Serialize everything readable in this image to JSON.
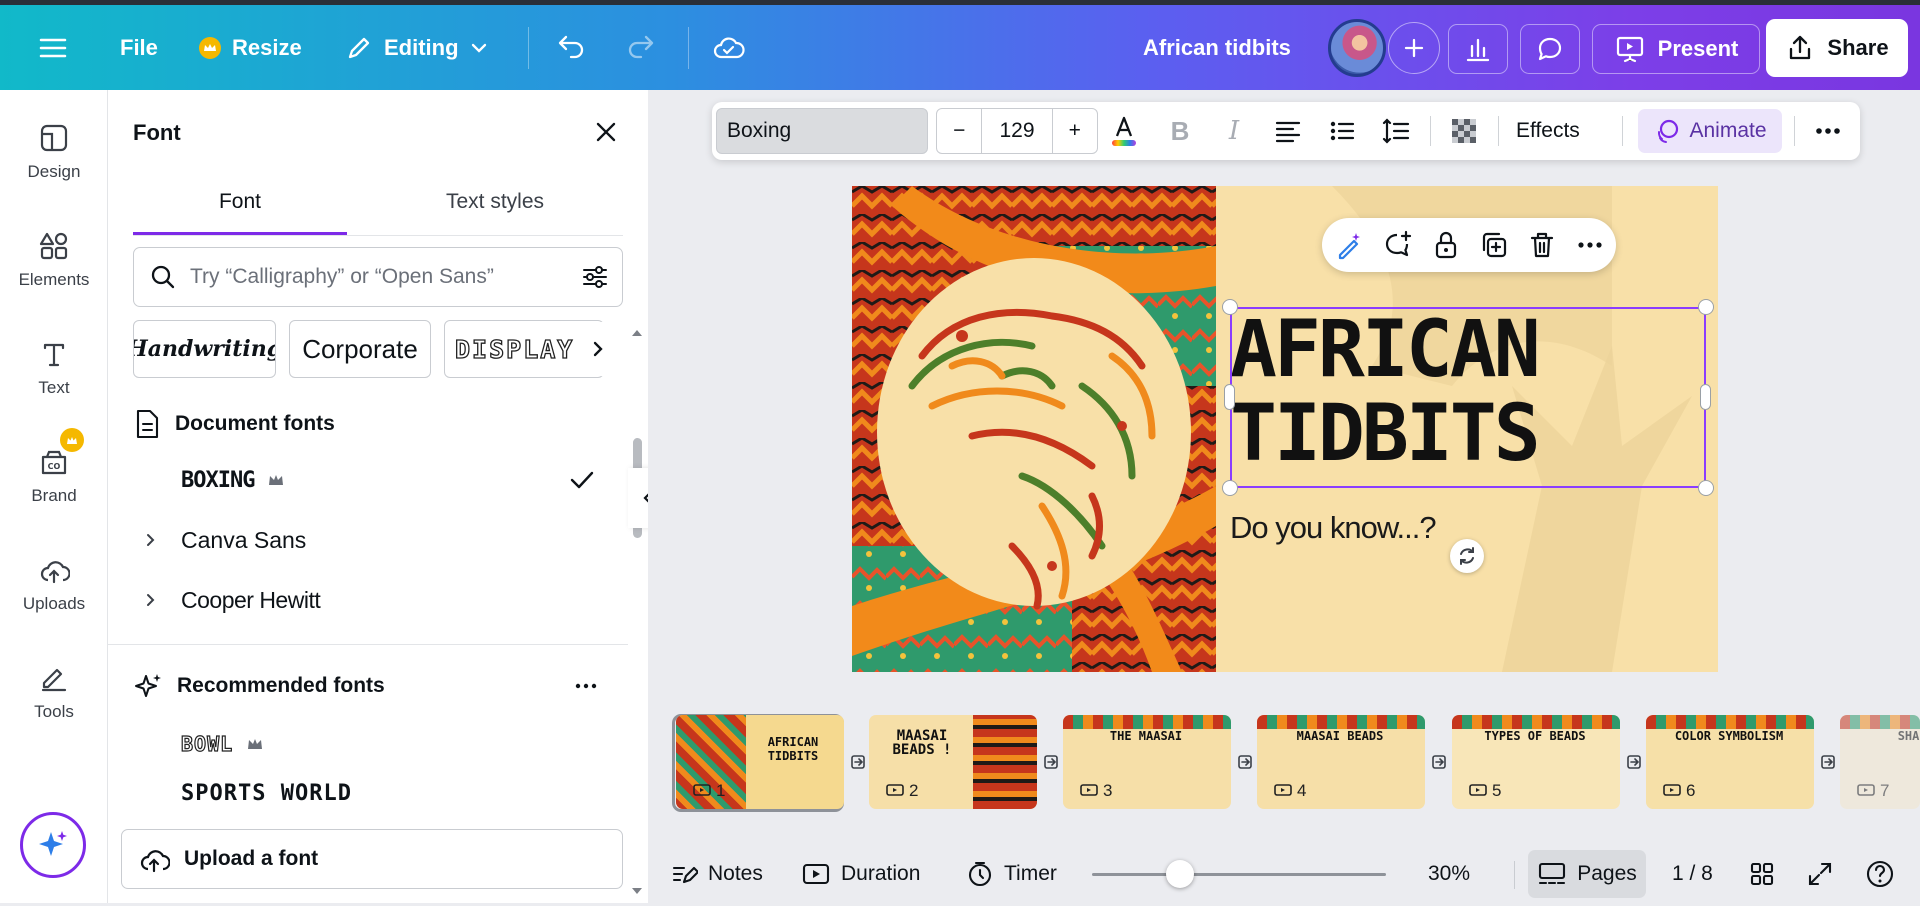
{
  "topbar": {
    "file_label": "File",
    "resize_label": "Resize",
    "editing_label": "Editing",
    "doc_title": "African tidbits",
    "present_label": "Present",
    "share_label": "Share"
  },
  "rail": {
    "items": [
      {
        "label": "Design",
        "icon": "design-icon"
      },
      {
        "label": "Elements",
        "icon": "elements-icon"
      },
      {
        "label": "Text",
        "icon": "text-icon"
      },
      {
        "label": "Brand",
        "icon": "brand-icon"
      },
      {
        "label": "Uploads",
        "icon": "uploads-icon"
      },
      {
        "label": "Tools",
        "icon": "tools-icon"
      }
    ]
  },
  "font_panel": {
    "title": "Font",
    "tabs": [
      "Font",
      "Text styles"
    ],
    "search_placeholder": "Try “Calligraphy” or “Open Sans”",
    "chips": [
      "Handwriting",
      "Corporate",
      "DISPLAY"
    ],
    "document_fonts_title": "Document fonts",
    "document_fonts": [
      "BOXING",
      "Canva Sans",
      "Cooper Hewitt"
    ],
    "recommended_title": "Recommended fonts",
    "recommended_fonts": [
      "BOWL",
      "SPORTS WORLD"
    ],
    "upload_label": "Upload a font"
  },
  "text_toolbar": {
    "font_name": "Boxing",
    "font_size": "129",
    "effects_label": "Effects",
    "animate_label": "Animate",
    "colors": {
      "accent": "#7d2ae8",
      "animate_bg": "#ece5fb"
    }
  },
  "slide": {
    "title_line1": "AFRICAN",
    "title_line2": "TIDBITS",
    "subtitle": "Do you know...?"
  },
  "pages": [
    {
      "num": "1",
      "title": "AFRICAN TIDBITS"
    },
    {
      "num": "2",
      "title": "MAASAI BEADS !"
    },
    {
      "num": "3",
      "title": "THE MAASAI"
    },
    {
      "num": "4",
      "title": "MAASAI BEADS"
    },
    {
      "num": "5",
      "title": "TYPES OF BEADS"
    },
    {
      "num": "6",
      "title": "COLOR SYMBOLISM"
    },
    {
      "num": "7",
      "title": "SHAPE S"
    }
  ],
  "bottombar": {
    "notes_label": "Notes",
    "duration_label": "Duration",
    "timer_label": "Timer",
    "zoom_value": "30%",
    "zoom_fraction": 0.3,
    "pages_label": "Pages",
    "page_indicator": "1 / 8"
  }
}
